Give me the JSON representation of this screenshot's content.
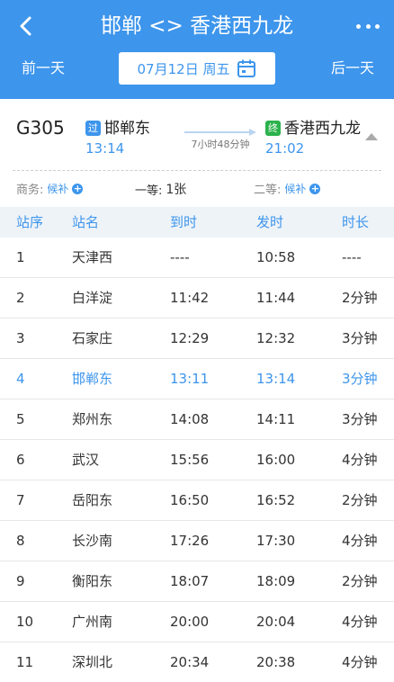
{
  "header": {
    "title": "邯郸 <> 香港西九龙",
    "prev_day": "前一天",
    "next_day": "后一天",
    "date": "07月12日 周五"
  },
  "train": {
    "number": "G305",
    "from_badge": "过",
    "from_station": "邯郸东",
    "depart_time": "13:14",
    "to_badge": "终",
    "to_station": "香港西九龙",
    "arrive_time": "21:02",
    "duration": "7小时48分钟"
  },
  "seats": [
    {
      "label": "商务:",
      "value": "候补",
      "plus": "+"
    },
    {
      "label": "一等:",
      "value": "1张",
      "plus": ""
    },
    {
      "label": "二等:",
      "value": "候补",
      "plus": "+"
    }
  ],
  "table": {
    "headers": [
      "站序",
      "站名",
      "到时",
      "发时",
      "时长"
    ],
    "rows": [
      [
        "1",
        "天津西",
        "----",
        "10:58",
        "----"
      ],
      [
        "2",
        "白洋淀",
        "11:42",
        "11:44",
        "2分钟"
      ],
      [
        "3",
        "石家庄",
        "12:29",
        "12:32",
        "3分钟"
      ],
      [
        "4",
        "邯郸东",
        "13:11",
        "13:14",
        "3分钟"
      ],
      [
        "5",
        "郑州东",
        "14:08",
        "14:11",
        "3分钟"
      ],
      [
        "6",
        "武汉",
        "15:56",
        "16:00",
        "4分钟"
      ],
      [
        "7",
        "岳阳东",
        "16:50",
        "16:52",
        "2分钟"
      ],
      [
        "8",
        "长沙南",
        "17:26",
        "17:30",
        "4分钟"
      ],
      [
        "9",
        "衡阳东",
        "18:07",
        "18:09",
        "2分钟"
      ],
      [
        "10",
        "广州南",
        "20:00",
        "20:04",
        "4分钟"
      ],
      [
        "11",
        "深圳北",
        "20:34",
        "20:38",
        "4分钟"
      ]
    ],
    "current_index": 3
  },
  "colors": {
    "accent": "#3d95ec",
    "start_badge": "#2bb24c"
  },
  "icons": {
    "back": "chevron-left-icon",
    "more": "more-dots-icon",
    "calendar": "calendar-icon",
    "collapse": "caret-up-icon"
  }
}
